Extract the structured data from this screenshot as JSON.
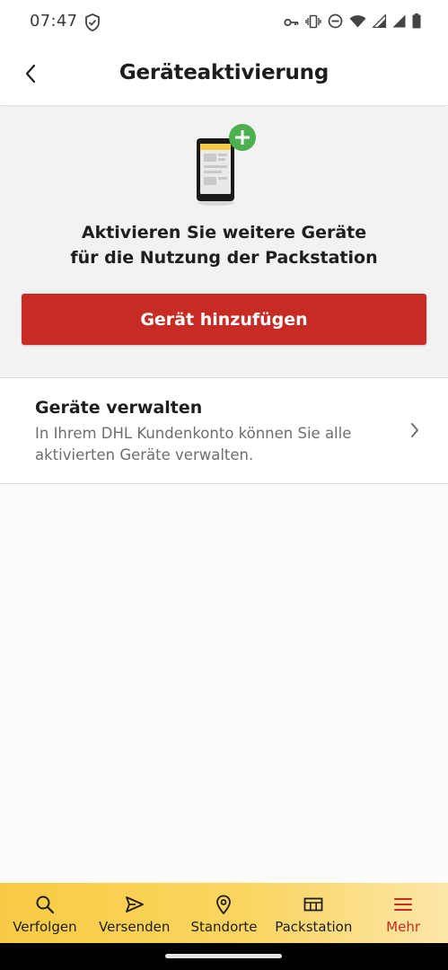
{
  "status_bar": {
    "time": "07:47",
    "icons": [
      "shield-check-icon",
      "key-icon",
      "vibrate-icon",
      "do-not-disturb-icon",
      "wifi-icon",
      "signal-icon",
      "signal-icon",
      "battery-icon"
    ]
  },
  "header": {
    "title": "Geräteaktivierung",
    "back_icon": "chevron-left-icon"
  },
  "hero": {
    "illustration": "phone-add-illustration",
    "text_line1": "Aktivieren Sie weitere Geräte",
    "text_line2": "für die Nutzung der Packstation",
    "button_label": "Gerät hinzufügen"
  },
  "manage": {
    "title": "Geräte verwalten",
    "description": "In Ihrem DHL Kundenkonto können Sie alle aktivierten Geräte verwalten.",
    "chevron_icon": "chevron-right-icon"
  },
  "bottom_nav": {
    "items": [
      {
        "label": "Verfolgen",
        "icon": "search-icon",
        "active": false
      },
      {
        "label": "Versenden",
        "icon": "send-icon",
        "active": false
      },
      {
        "label": "Standorte",
        "icon": "location-pin-icon",
        "active": false
      },
      {
        "label": "Packstation",
        "icon": "packstation-icon",
        "active": false
      },
      {
        "label": "Mehr",
        "icon": "menu-icon",
        "active": true
      }
    ]
  },
  "colors": {
    "brand_red": "#c62b24",
    "brand_yellow": "#f8cb44",
    "plus_green": "#4caf50"
  }
}
